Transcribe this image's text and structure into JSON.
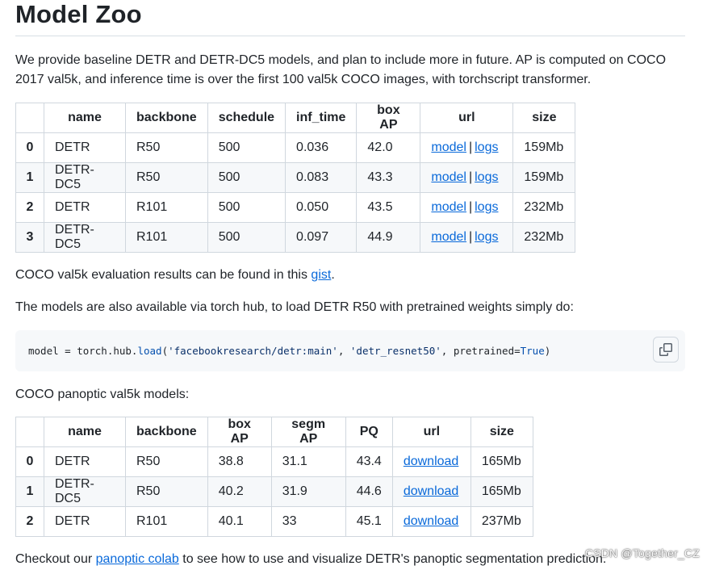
{
  "heading": "Model Zoo",
  "intro": {
    "text": "We provide baseline DETR and DETR-DC5 models, and plan to include more in future. AP is computed on COCO 2017 val5k, and inference time is over the first 100 val5k COCO images, with torchscript transformer."
  },
  "table1": {
    "headers": [
      "",
      "name",
      "backbone",
      "schedule",
      "inf_time",
      "box AP",
      "url",
      "size"
    ],
    "rows": [
      {
        "idx": "0",
        "name": "DETR",
        "backbone": "R50",
        "schedule": "500",
        "inf_time": "0.036",
        "box_ap": "42.0",
        "model": "model",
        "sep": "|",
        "logs": "logs",
        "size": "159Mb"
      },
      {
        "idx": "1",
        "name": "DETR-DC5",
        "backbone": "R50",
        "schedule": "500",
        "inf_time": "0.083",
        "box_ap": "43.3",
        "model": "model",
        "sep": "|",
        "logs": "logs",
        "size": "159Mb"
      },
      {
        "idx": "2",
        "name": "DETR",
        "backbone": "R101",
        "schedule": "500",
        "inf_time": "0.050",
        "box_ap": "43.5",
        "model": "model",
        "sep": "|",
        "logs": "logs",
        "size": "232Mb"
      },
      {
        "idx": "3",
        "name": "DETR-DC5",
        "backbone": "R101",
        "schedule": "500",
        "inf_time": "0.097",
        "box_ap": "44.9",
        "model": "model",
        "sep": "|",
        "logs": "logs",
        "size": "232Mb"
      }
    ]
  },
  "note1": {
    "before": "COCO val5k evaluation results can be found in this ",
    "link": "gist",
    "after": "."
  },
  "note2": {
    "text": "The models are also available via torch hub, to load DETR R50 with pretrained weights simply do:"
  },
  "code": {
    "p1": "model = torch.hub.",
    "fn": "load",
    "p2": "(",
    "s1": "'facebookresearch/detr:main'",
    "p3": ", ",
    "s2": "'detr_resnet50'",
    "p4": ", pretrained=",
    "kw": "True",
    "p5": ")",
    "copy_icon": "copy-icon"
  },
  "note3": {
    "text": "COCO panoptic val5k models:"
  },
  "table2": {
    "headers": [
      "",
      "name",
      "backbone",
      "box AP",
      "segm AP",
      "PQ",
      "url",
      "size"
    ],
    "rows": [
      {
        "idx": "0",
        "name": "DETR",
        "backbone": "R50",
        "box_ap": "38.8",
        "segm_ap": "31.1",
        "pq": "43.4",
        "url": "download",
        "size": "165Mb"
      },
      {
        "idx": "1",
        "name": "DETR-DC5",
        "backbone": "R50",
        "box_ap": "40.2",
        "segm_ap": "31.9",
        "pq": "44.6",
        "url": "download",
        "size": "165Mb"
      },
      {
        "idx": "2",
        "name": "DETR",
        "backbone": "R101",
        "box_ap": "40.1",
        "segm_ap": "33",
        "pq": "45.1",
        "url": "download",
        "size": "237Mb"
      }
    ]
  },
  "note4": {
    "before": "Checkout our ",
    "link": "panoptic colab",
    "after": " to see how to use and visualize DETR's panoptic segmentation prediction."
  },
  "watermark": "CSDN @Together_CZ",
  "colors": {
    "link": "#0969da",
    "text": "#1f2328",
    "stripe": "#f6f8fa",
    "border": "#d0d7de"
  }
}
